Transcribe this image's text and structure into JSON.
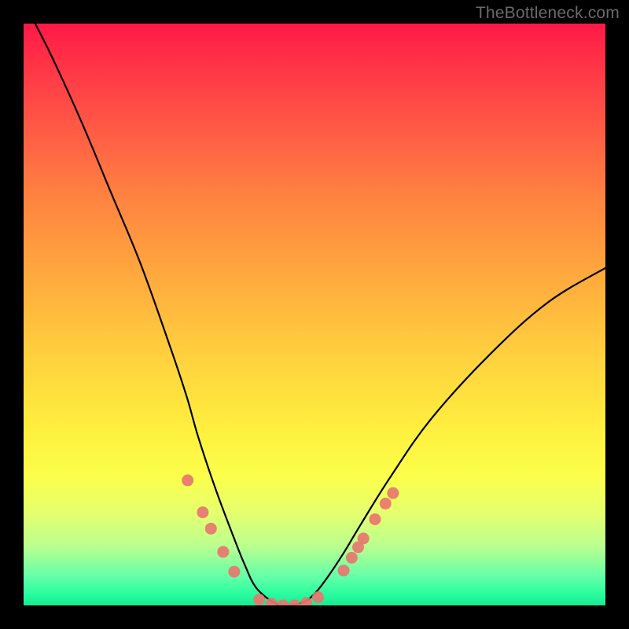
{
  "watermark": "TheBottleneck.com",
  "colors": {
    "marker_fill": "#e8766f",
    "curve_stroke": "#000000",
    "frame_bg": "#000000"
  },
  "chart_data": {
    "type": "line",
    "title": "",
    "xlabel": "",
    "ylabel": "",
    "xlim": [
      0,
      100
    ],
    "ylim": [
      0,
      100
    ],
    "grid": false,
    "legend": false,
    "note": "V-shaped bottleneck curve on rainbow gradient background; y ~ bottleneck %, apex at x≈45 y≈0.",
    "series": [
      {
        "name": "curve",
        "x": [
          2,
          5,
          10,
          15,
          20,
          25,
          28,
          30,
          33,
          36,
          38,
          40,
          43,
          45,
          48,
          50,
          52,
          55,
          58,
          63,
          70,
          80,
          90,
          100
        ],
        "y": [
          100,
          94,
          83,
          71,
          59,
          45,
          36,
          29,
          20,
          12,
          7,
          3,
          0.5,
          0,
          0.5,
          2,
          4.5,
          9,
          14,
          22,
          32,
          43,
          52,
          58
        ]
      }
    ],
    "markers": [
      {
        "x": 28.2,
        "y": 21.5
      },
      {
        "x": 30.8,
        "y": 16.0
      },
      {
        "x": 32.2,
        "y": 13.2
      },
      {
        "x": 34.3,
        "y": 9.2
      },
      {
        "x": 36.2,
        "y": 5.8
      },
      {
        "x": 40.5,
        "y": 1.0
      },
      {
        "x": 42.6,
        "y": 0.3
      },
      {
        "x": 44.6,
        "y": 0.0
      },
      {
        "x": 46.6,
        "y": 0.0
      },
      {
        "x": 48.6,
        "y": 0.4
      },
      {
        "x": 50.6,
        "y": 1.4
      },
      {
        "x": 55.0,
        "y": 6.0
      },
      {
        "x": 56.4,
        "y": 8.2
      },
      {
        "x": 57.5,
        "y": 10.0
      },
      {
        "x": 58.4,
        "y": 11.5
      },
      {
        "x": 60.4,
        "y": 14.8
      },
      {
        "x": 62.2,
        "y": 17.5
      },
      {
        "x": 63.5,
        "y": 19.3
      }
    ]
  }
}
